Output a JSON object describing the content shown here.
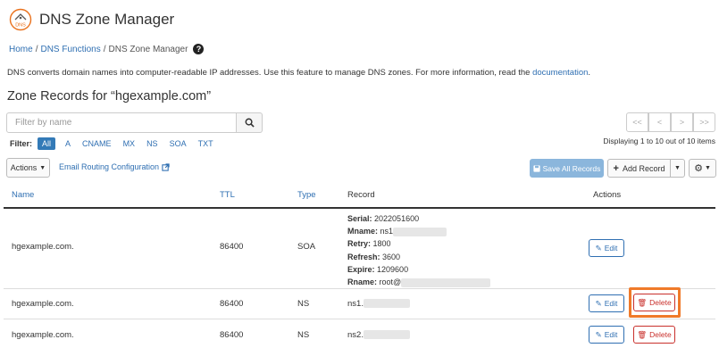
{
  "header": {
    "title": "DNS Zone Manager",
    "icon_text": "DNS",
    "icon_color": "#e9711c"
  },
  "breadcrumb": {
    "home": "Home",
    "sep": "/",
    "functions": "DNS Functions",
    "current": "DNS Zone Manager",
    "help": "?"
  },
  "description": {
    "text": "DNS converts domain names into computer-readable IP addresses. Use this feature to manage DNS zones. For more information, read the ",
    "link": "documentation",
    "end": "."
  },
  "zone_heading": "Zone Records for “hgexample.com”",
  "search": {
    "placeholder": "Filter by name"
  },
  "filter": {
    "label": "Filter:",
    "items": [
      "All",
      "A",
      "CNAME",
      "MX",
      "NS",
      "SOA",
      "TXT"
    ],
    "active": "All"
  },
  "pagination": {
    "first": "<<",
    "prev": "<",
    "next": ">",
    "last": ">>",
    "status": "Displaying 1 to 10 out of 10 items"
  },
  "toolbar": {
    "actions": "Actions",
    "email_routing": "Email Routing Configuration",
    "save_all": "Save All Records",
    "add_record": "Add Record"
  },
  "table": {
    "headers": {
      "name": "Name",
      "ttl": "TTL",
      "type": "Type",
      "record": "Record",
      "actions": "Actions"
    },
    "rows": [
      {
        "name": "hgexample.com.",
        "ttl": "86400",
        "type": "SOA",
        "soa": {
          "serial_label": "Serial:",
          "serial": "2022051600",
          "mname_label": "Mname:",
          "mname": "ns1",
          "retry_label": "Retry:",
          "retry": "1800",
          "refresh_label": "Refresh:",
          "refresh": "3600",
          "expire_label": "Expire:",
          "expire": "1209600",
          "rname_label": "Rname:",
          "rname": "root@"
        },
        "edit": "Edit"
      },
      {
        "name": "hgexample.com.",
        "ttl": "86400",
        "type": "NS",
        "record": "ns1.",
        "edit": "Edit",
        "delete": "Delete"
      },
      {
        "name": "hgexample.com.",
        "ttl": "86400",
        "type": "NS",
        "record": "ns2.",
        "edit": "Edit",
        "delete": "Delete"
      }
    ]
  },
  "colors": {
    "link": "#2f6fb2",
    "delete": "#c9302c",
    "highlight": "#f07a2a",
    "save_button": "#8bb6dc"
  }
}
